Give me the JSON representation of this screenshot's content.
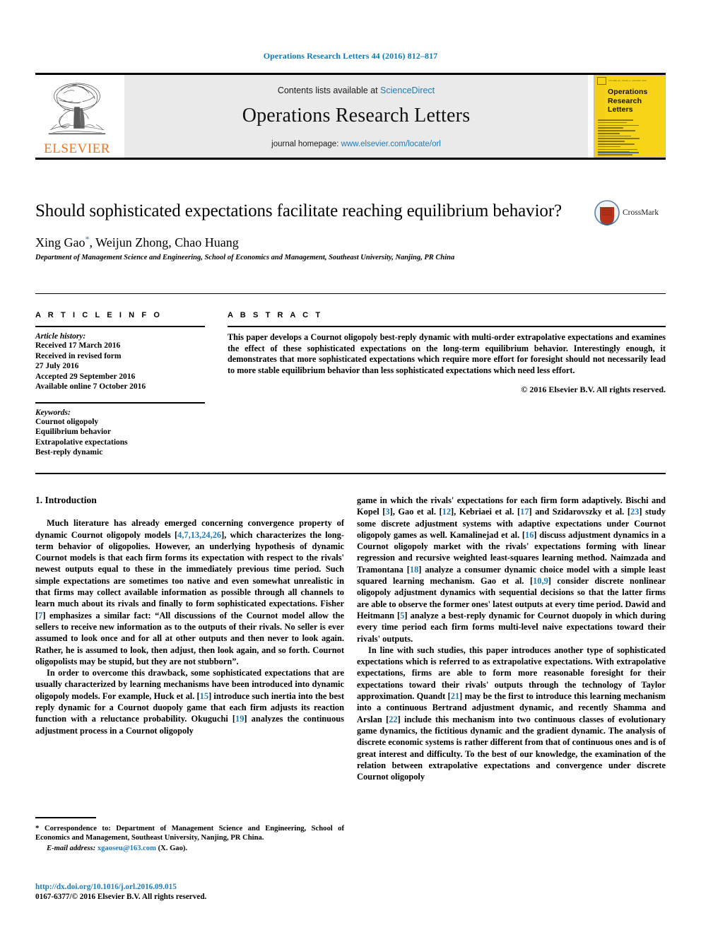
{
  "running_head": "Operations Research Letters 44 (2016) 812–817",
  "masthead": {
    "publisher": "ELSEVIER",
    "contents_prefix": "Contents lists available at ",
    "contents_link": "ScienceDirect",
    "journal_name": "Operations Research Letters",
    "homepage_prefix": "journal homepage: ",
    "homepage_link": "www.elsevier.com/locate/orl",
    "cover": {
      "title_line1": "Operations",
      "title_line2": "Research",
      "title_line3": "Letters",
      "masthead_left": "VOLUME 44 | ISSUE 1 | JANUARY 2016",
      "masthead_right": "ISSN 0167-6377",
      "accent_color": "#f7d417"
    }
  },
  "article": {
    "title": "Should sophisticated expectations facilitate reaching equilibrium behavior?",
    "authors": "Xing Gao",
    "authors_rest": ", Weijun Zhong, Chao Huang",
    "corresponding_marker": "*",
    "affiliation": "Department of Management Science and Engineering, School of Economics and Management, Southeast University, Nanjing, PR China",
    "crossmark_label": "CrossMark"
  },
  "info": {
    "heading": "A R T I C L E   I N F O",
    "history_label": "Article history:",
    "history": [
      "Received 17 March 2016",
      "Received in revised form",
      "27 July 2016",
      "Accepted 29 September 2016",
      "Available online 7 October 2016"
    ],
    "keywords_label": "Keywords:",
    "keywords": [
      "Cournot oligopoly",
      "Equilibrium behavior",
      "Extrapolative expectations",
      "Best-reply dynamic"
    ]
  },
  "abstract": {
    "heading": "A B S T R A C T",
    "text": "This paper develops a Cournot oligopoly best-reply dynamic with multi-order extrapolative expectations and examines the effect of these sophisticated expectations on the long-term equilibrium behavior. Interestingly enough, it demonstrates that more sophisticated expectations which require more effort for foresight should not necessarily lead to more stable equilibrium behavior than less sophisticated expectations which need less effort.",
    "copyright": "© 2016 Elsevier B.V. All rights reserved."
  },
  "body": {
    "section_heading": "1. Introduction",
    "left_p1_a": "Much literature has already emerged concerning convergence property of dynamic Cournot oligopoly models [",
    "left_p1_ref1": "4,7,13,24,26",
    "left_p1_b": "], which characterizes the long-term behavior of oligopolies. However, an underlying hypothesis of dynamic Cournot models is that each firm forms its expectation with respect to the rivals' newest outputs equal to these in the immediately previous time period. Such simple expectations are sometimes too native and even somewhat unrealistic in that firms may collect available information as possible through all channels to learn much about its rivals and finally to form sophisticated expectations. Fisher [",
    "left_p1_ref2": "7",
    "left_p1_c": "] emphasizes a similar fact: “All discussions of the Cournot model allow the sellers to receive new information as to the outputs of their rivals. No seller is ever assumed to look once and for all at other outputs and then never to look again. Rather, he is assumed to look, then adjust, then look again, and so forth. Cournot oligopolists may be stupid, but they are not stubborn”.",
    "left_p2_a": "In order to overcome this drawback, some sophisticated expectations that are usually characterized by learning mechanisms have been introduced into dynamic oligopoly models. For example, Huck et al. [",
    "left_p2_ref1": "15",
    "left_p2_b": "] introduce such inertia into the best reply dynamic for a Cournot duopoly game that each firm adjusts its reaction function with a reluctance probability. Okuguchi [",
    "left_p2_ref2": "19",
    "left_p2_c": "] analyzes the continuous adjustment process in a Cournot oligopoly",
    "right_p1_a": "game in which the rivals' expectations for each firm form adaptively. Bischi and Kopel [",
    "right_p1_ref1": "3",
    "right_p1_b": "], Gao et al. [",
    "right_p1_ref2": "12",
    "right_p1_c": "], Kebriaei et al. [",
    "right_p1_ref3": "17",
    "right_p1_d": "] and Szidarovszky et al. [",
    "right_p1_ref4": "23",
    "right_p1_e": "] study some discrete adjustment systems with adaptive expectations under Cournot oligopoly games as well. Kamalinejad et al. [",
    "right_p1_ref5": "16",
    "right_p1_f": "] discuss adjustment dynamics in a Cournot oligopoly market with the rivals' expectations forming with linear regression and recursive weighted least-squares learning method. Naimzada and Tramontana [",
    "right_p1_ref6": "18",
    "right_p1_g": "] analyze a consumer dynamic choice model with a simple least squared learning mechanism. Gao et al. [",
    "right_p1_ref7": "10,9",
    "right_p1_h": "] consider discrete nonlinear oligopoly adjustment dynamics with sequential decisions so that the latter firms are able to observe the former ones' latest outputs at every time period. Dawid and Heitmann [",
    "right_p1_ref8": "5",
    "right_p1_i": "] analyze a best-reply dynamic for Cournot duopoly in which during every time period each firm forms multi-level naive expectations toward their rivals' outputs.",
    "right_p2_a": "In line with such studies, this paper introduces another type of sophisticated expectations which is referred to as extrapolative expectations. With extrapolative expectations, firms are able to form more reasonable foresight for their expectations toward their rivals' outputs through the technology of Taylor approximation. Quandt [",
    "right_p2_ref1": "21",
    "right_p2_b": "] may be the first to introduce this learning mechanism into a continuous Bertrand adjustment dynamic, and recently Shamma and Arslan [",
    "right_p2_ref2": "22",
    "right_p2_c": "] include this mechanism into two continuous classes of evolutionary game dynamics, the fictitious dynamic and the gradient dynamic. The analysis of discrete economic systems is rather different from that of continuous ones and is of great interest and difficulty. To the best of our knowledge, the examination of the relation between extrapolative expectations and convergence under discrete Cournot oligopoly"
  },
  "footer": {
    "correspondence_star": "*",
    "correspondence": "Correspondence to: Department of Management Science and Engineering, School of Economics and Management, Southeast University, Nanjing, PR China.",
    "email_label": "E-mail address:",
    "email": "xgaoseu@163.com",
    "email_suffix": "(X. Gao).",
    "doi": "http://dx.doi.org/10.1016/j.orl.2016.09.015",
    "issn_line": "0167-6377/© 2016 Elsevier B.V. All rights reserved."
  },
  "colors": {
    "link_blue": "#1e7ab8",
    "elsevier_orange": "#ec7623",
    "band_grey": "#eaeaea",
    "cover_yellow": "#f7d417"
  }
}
